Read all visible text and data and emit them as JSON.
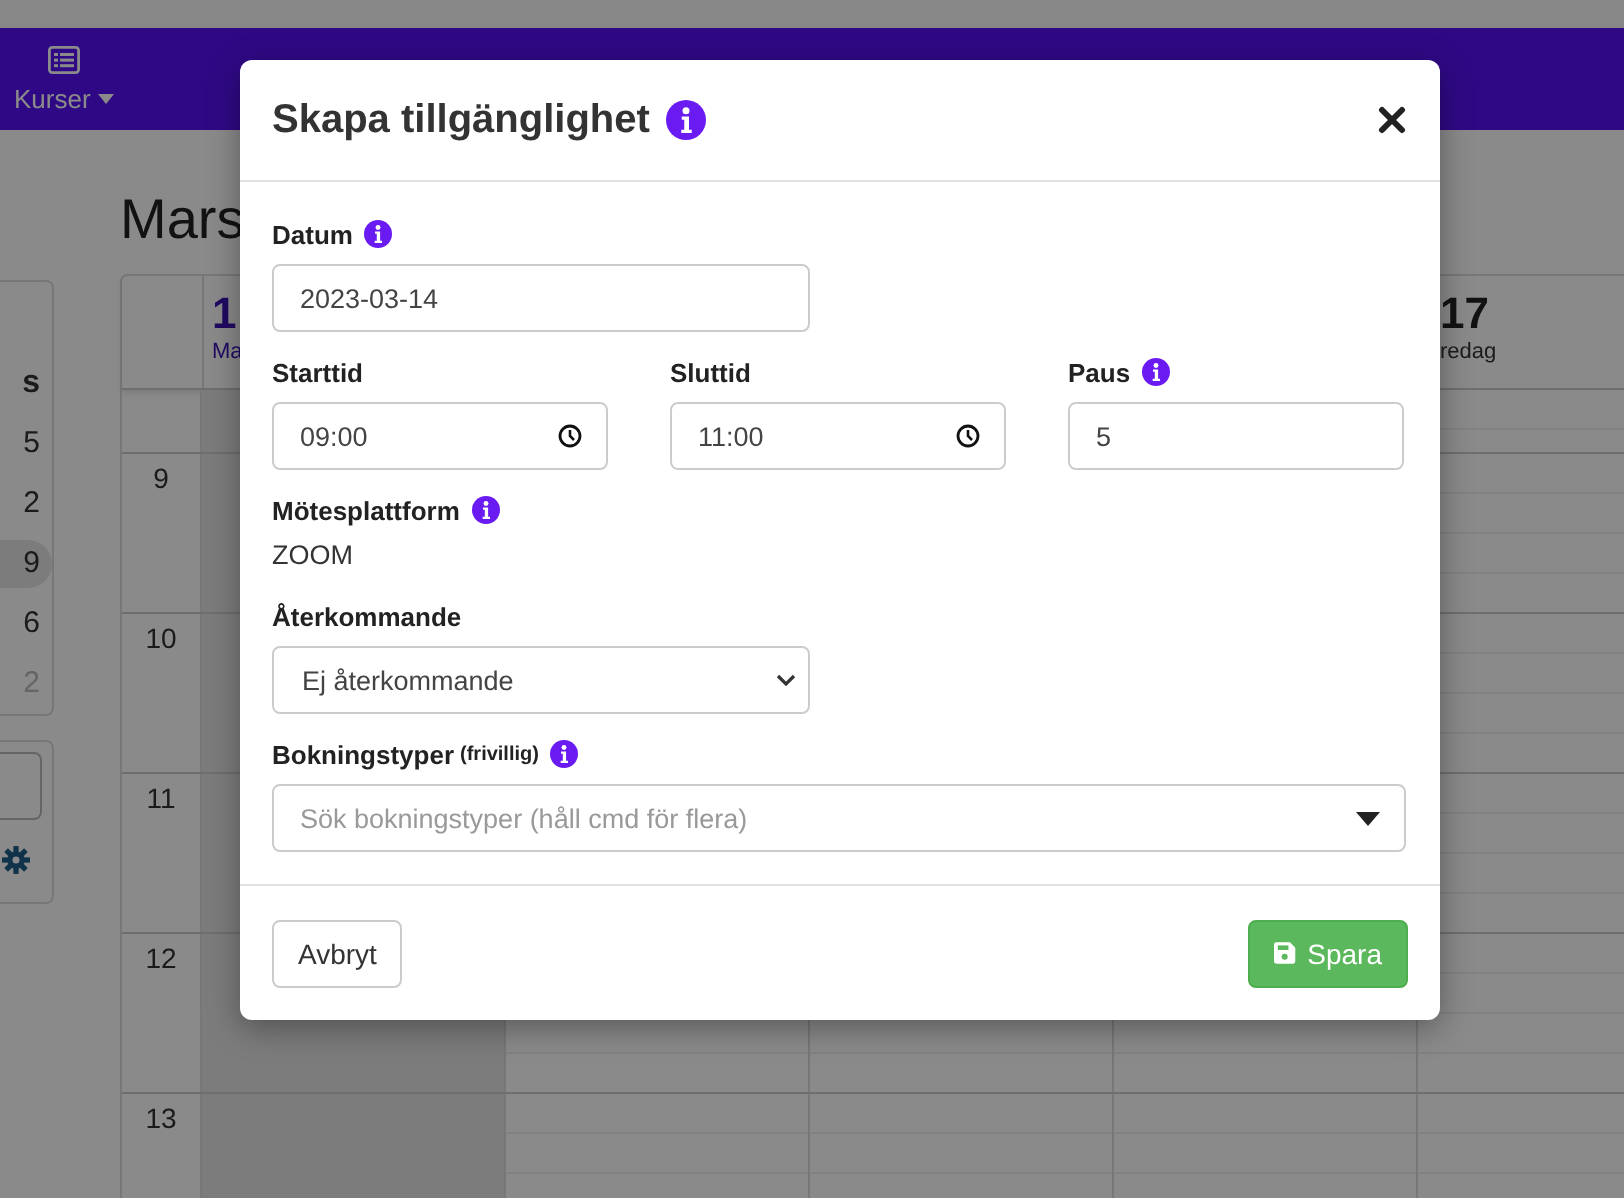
{
  "navbar": {
    "items": [
      {
        "label": "Kurser"
      }
    ]
  },
  "page_title": "Mars",
  "mini_calendar": {
    "heading": "s",
    "days": [
      {
        "label": "5",
        "selected": false,
        "muted": false
      },
      {
        "label": "2",
        "selected": false,
        "muted": false
      },
      {
        "label": "9",
        "selected": true,
        "muted": false
      },
      {
        "label": "6",
        "selected": false,
        "muted": false
      },
      {
        "label": "2",
        "selected": false,
        "muted": true
      }
    ]
  },
  "calendar": {
    "hours": [
      "9",
      "10",
      "11",
      "12",
      "13"
    ],
    "days": [
      {
        "number": "1",
        "weekday": "Ma",
        "today": true
      },
      {
        "number": "17",
        "weekday": "redag",
        "today": false
      }
    ]
  },
  "dialog": {
    "title": "Skapa tillgänglighet",
    "title_info": true,
    "date": {
      "label": "Datum",
      "info": true,
      "value": "2023-03-14"
    },
    "times": [
      {
        "kind": "time",
        "label": "Starttid",
        "info": false,
        "value": "09:00"
      },
      {
        "kind": "time",
        "label": "Sluttid",
        "info": false,
        "value": "11:00"
      },
      {
        "kind": "number",
        "label": "Paus",
        "info": true,
        "value": "5"
      }
    ],
    "platform": {
      "label": "Mötesplattform",
      "info": true,
      "value": "ZOOM"
    },
    "recurring": {
      "label": "Återkommande",
      "value": "Ej återkommande"
    },
    "booking_types": {
      "label": "Bokningstyper",
      "hint": "(frivillig)",
      "info": true,
      "placeholder": "Sök bokningstyper (håll cmd för flera)"
    },
    "buttons": [
      {
        "kind": "cancel",
        "label": "Avbryt"
      },
      {
        "kind": "save",
        "label": "Spara"
      }
    ]
  }
}
